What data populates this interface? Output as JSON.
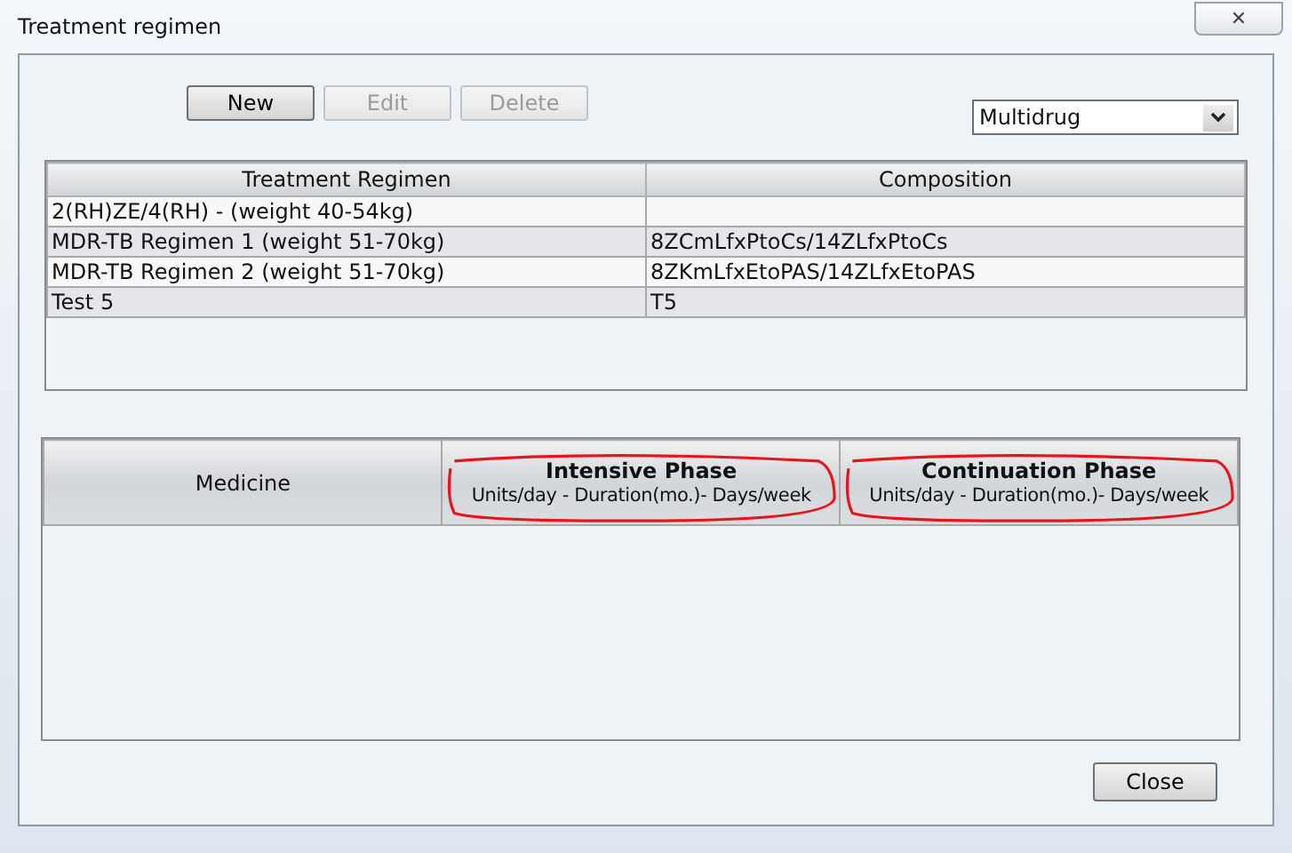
{
  "window": {
    "title": "Treatment regimen",
    "close_symbol": "✕"
  },
  "toolbar": {
    "buttons": [
      {
        "label": "New",
        "disabled": false
      },
      {
        "label": "Edit",
        "disabled": true
      },
      {
        "label": "Delete",
        "disabled": true
      }
    ],
    "filter": {
      "value": "Multidrug"
    }
  },
  "regimen_table": {
    "columns": [
      "Treatment Regimen",
      "Composition"
    ],
    "rows": [
      [
        "2(RH)ZE/4(RH) - (weight 40-54kg)",
        ""
      ],
      [
        "MDR-TB Regimen 1 (weight 51-70kg)",
        "8ZCmLfxPtoCs/14ZLfxPtoCs"
      ],
      [
        "MDR-TB Regimen 2 (weight 51-70kg)",
        "8ZKmLfxEtoPAS/14ZLfxEtoPAS"
      ],
      [
        "Test 5",
        "T5"
      ]
    ]
  },
  "medicine_table": {
    "columns": [
      {
        "title": "Medicine",
        "highlighted": false
      },
      {
        "title": "Intensive Phase",
        "subtitle": "Units/day - Duration(mo.)- Days/week",
        "highlighted": true
      },
      {
        "title": "Continuation Phase",
        "subtitle": "Units/day - Duration(mo.)- Days/week",
        "highlighted": true
      }
    ]
  },
  "footer": {
    "buttons": [
      "Close"
    ]
  }
}
